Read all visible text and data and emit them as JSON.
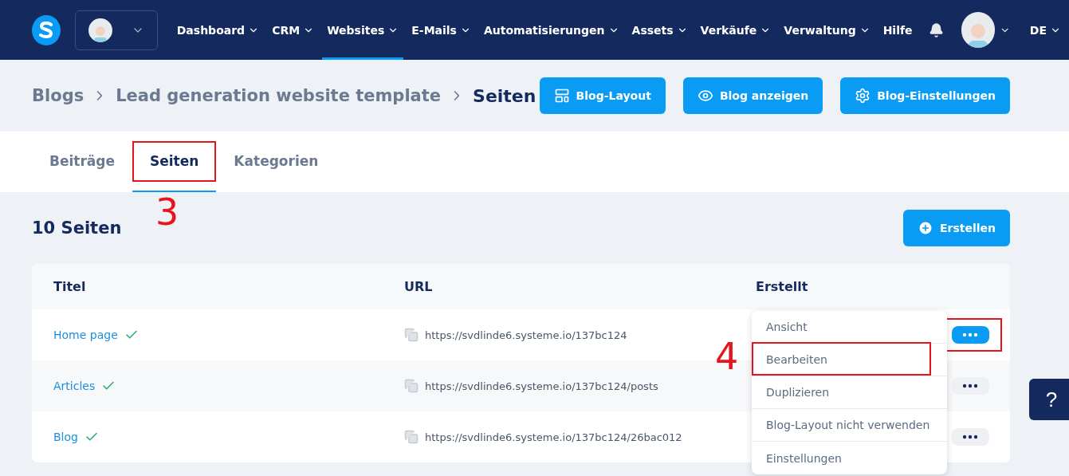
{
  "nav": {
    "items": [
      {
        "label": "Dashboard",
        "selected": false,
        "dropdown": true
      },
      {
        "label": "CRM",
        "selected": false,
        "dropdown": true
      },
      {
        "label": "Websites",
        "selected": true,
        "dropdown": true
      },
      {
        "label": "E-Mails",
        "selected": false,
        "dropdown": true
      },
      {
        "label": "Automatisierungen",
        "selected": false,
        "dropdown": true
      },
      {
        "label": "Assets",
        "selected": false,
        "dropdown": true
      },
      {
        "label": "Verkäufe",
        "selected": false,
        "dropdown": true
      },
      {
        "label": "Verwaltung",
        "selected": false,
        "dropdown": true
      },
      {
        "label": "Hilfe",
        "selected": false,
        "dropdown": false
      }
    ],
    "language": "DE"
  },
  "breadcrumb": [
    "Blogs",
    "Lead generation website template",
    "Seiten"
  ],
  "header_buttons": [
    "Blog-Layout",
    "Blog anzeigen",
    "Blog-Einstellungen"
  ],
  "tabs": [
    {
      "label": "Beiträge",
      "selected": false,
      "highlighted": false
    },
    {
      "label": "Seiten",
      "selected": true,
      "highlighted": true
    },
    {
      "label": "Kategorien",
      "selected": false,
      "highlighted": false
    }
  ],
  "count_title": "10 Seiten",
  "create_button": "Erstellen",
  "table": {
    "columns": [
      "Titel",
      "URL",
      "Erstellt"
    ],
    "rows": [
      {
        "title": "Home page",
        "published": true,
        "url": "https://svdlinde6.systeme.io/137bc124",
        "menu_open": true,
        "highlighted": true
      },
      {
        "title": "Articles",
        "published": true,
        "url": "https://svdlinde6.systeme.io/137bc124/posts",
        "menu_open": false,
        "highlighted": false
      },
      {
        "title": "Blog",
        "published": true,
        "url": "https://svdlinde6.systeme.io/137bc124/26bac012",
        "menu_open": false,
        "highlighted": false
      }
    ]
  },
  "row_menu": [
    {
      "label": "Ansicht",
      "highlighted": false
    },
    {
      "label": "Bearbeiten",
      "highlighted": true
    },
    {
      "label": "Duplizieren",
      "highlighted": false
    },
    {
      "label": "Blog-Layout nicht verwenden",
      "highlighted": false
    },
    {
      "label": "Einstellungen",
      "highlighted": false
    }
  ],
  "annotations": [
    {
      "number": "3"
    },
    {
      "number": "4"
    }
  ],
  "help_button": "?"
}
